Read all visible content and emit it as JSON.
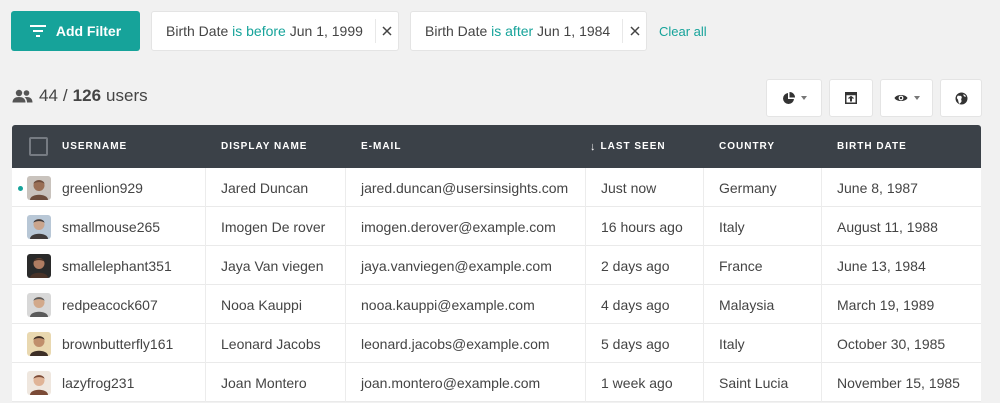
{
  "filters": {
    "add_label": "Add Filter",
    "chips": [
      {
        "field": "Birth Date",
        "op": "is before",
        "value": "Jun 1, 1999"
      },
      {
        "field": "Birth Date",
        "op": "is after",
        "value": "Jun 1, 1984"
      }
    ],
    "clear_label": "Clear all"
  },
  "count": {
    "shown": "44",
    "separator": "/",
    "total": "126",
    "unit": "users"
  },
  "table": {
    "headers": {
      "username": "USERNAME",
      "display_name": "DISPLAY NAME",
      "email": "E-MAIL",
      "last_seen": "LAST SEEN",
      "sort_arrow": "↓",
      "country": "COUNTRY",
      "birth_date": "BIRTH DATE"
    },
    "rows": [
      {
        "username": "greenlion929",
        "display_name": "Jared Duncan",
        "email": "jared.duncan@usersinsights.com",
        "last_seen": "Just now",
        "country": "Germany",
        "birth_date": "June 8, 1987",
        "online": true
      },
      {
        "username": "smallmouse265",
        "display_name": "Imogen De rover",
        "email": "imogen.derover@example.com",
        "last_seen": "16 hours ago",
        "country": "Italy",
        "birth_date": "August 11, 1988",
        "online": false
      },
      {
        "username": "smallelephant351",
        "display_name": "Jaya Van viegen",
        "email": "jaya.vanviegen@example.com",
        "last_seen": "2 days ago",
        "country": "France",
        "birth_date": "June 13, 1984",
        "online": false
      },
      {
        "username": "redpeacock607",
        "display_name": "Nooa Kauppi",
        "email": "nooa.kauppi@example.com",
        "last_seen": "4 days ago",
        "country": "Malaysia",
        "birth_date": "March 19, 1989",
        "online": false
      },
      {
        "username": "brownbutterfly161",
        "display_name": "Leonard Jacobs",
        "email": "leonard.jacobs@example.com",
        "last_seen": "5 days ago",
        "country": "Italy",
        "birth_date": "October 30, 1985",
        "online": false
      },
      {
        "username": "lazyfrog231",
        "display_name": "Joan Montero",
        "email": "joan.montero@example.com",
        "last_seen": "1 week ago",
        "country": "Saint Lucia",
        "birth_date": "November 15, 1985",
        "online": false
      }
    ]
  },
  "colors": {
    "accent": "#16a39a",
    "header_bg": "#3b4148",
    "page_bg": "#f1f1f1"
  },
  "icons": {
    "add_filter": "filter-lines-icon",
    "chip_close": "close-icon",
    "count": "users-icon",
    "toolbar": [
      "pie-chart-icon",
      "layout-icon",
      "eye-icon",
      "globe-icon"
    ]
  }
}
